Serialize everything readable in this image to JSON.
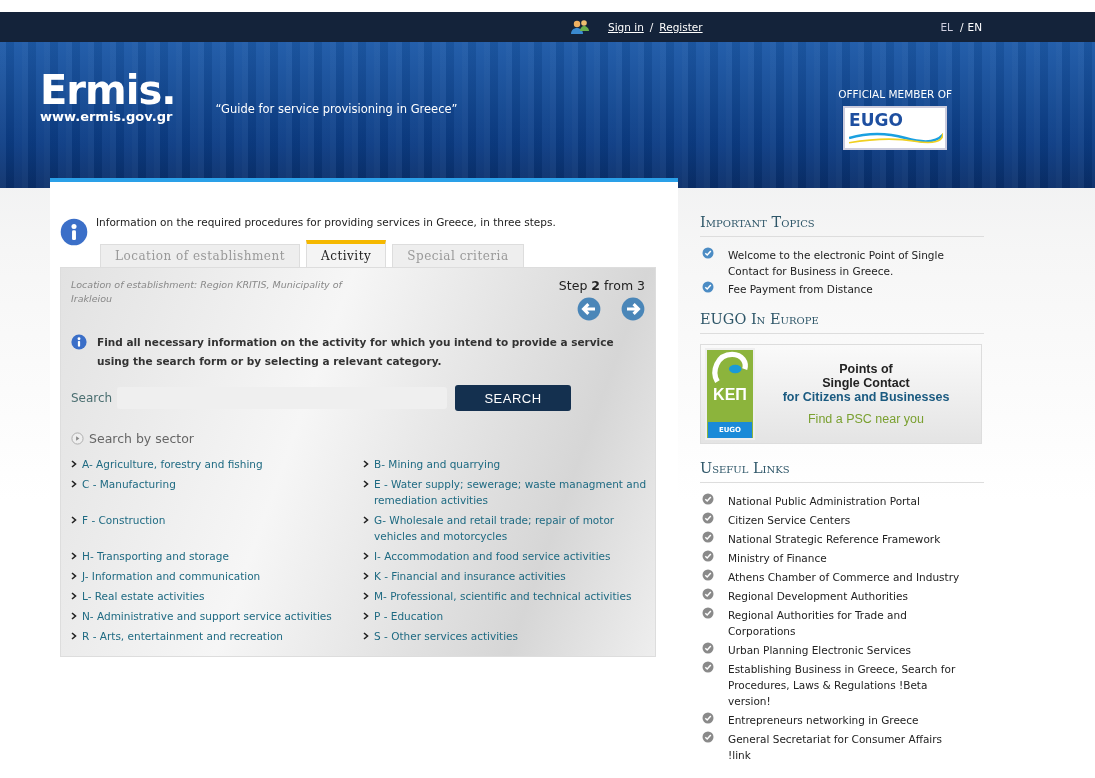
{
  "top_bar": {
    "sign_in": "Sign in",
    "separator": "/",
    "register": "Register",
    "languages": [
      {
        "label": "EL",
        "selected": false
      },
      {
        "label": "EN",
        "selected": true
      }
    ],
    "language_separator": "/"
  },
  "header": {
    "logo": "Ermis.",
    "site_url": "www.ermis.gov.gr",
    "tagline": "“Guide for service provisioning in Greece”",
    "member_label": "OFFICIAL MEMBER OF",
    "member_logo": "EUGO"
  },
  "intro": "Information on the required procedures for providing services in Greece, in three steps.",
  "tabs": [
    {
      "label": "Location of establishment",
      "selected": false
    },
    {
      "label": "Activity",
      "selected": true
    },
    {
      "label": "Special criteria",
      "selected": false
    }
  ],
  "location_note": "Location of establishment: Region KRITIS, Municipality of Irakleiou",
  "step": "Step **2** from 3",
  "hint": "Find all necessary information on the activity for which you intend to provide a service using the search form or by selecting a relevant category.",
  "search": {
    "label": "Search",
    "button": "SEARCH"
  },
  "sector_title": "Search by sector",
  "sectors": [
    "A- Agriculture, forestry and fishing",
    "B- Mining and quarrying",
    "C - Manufacturing",
    "E - Water supply; sewerage; waste managment and remediation activities",
    "F - Construction",
    "G- Wholesale and retail trade; repair of motor vehicles and motorcycles",
    "H- Transporting and storage",
    "I- Accommodation and food service activities",
    "J- Information and communication",
    "K - Financial and insurance activities",
    "L- Real estate activities",
    "M- Professional, scientific and technical activities",
    "N- Administrative and support service activities",
    "P - Education",
    "R - Arts, entertainment and recreation",
    "S - Other services activities"
  ],
  "important_topics": {
    "title": "Important Topics",
    "items": [
      "Welcome to the electronic Point of Single Contact for Business in Greece.",
      "Fee Payment from Distance"
    ]
  },
  "eugo": {
    "title": "EUGO In Europe",
    "logo_text": "KEΠ",
    "logo_badge": "EUGO",
    "lines": [
      "Points of",
      "Single Contact"
    ],
    "subtitle": "for Citizens and Businesses",
    "link": "Find a PSC near you"
  },
  "useful_links": {
    "title": "Useful Links",
    "items": [
      "National Public Administration Portal",
      "Citizen Service Centers",
      "National Strategic Reference Framework",
      "Ministry of Finance",
      "Athens Chamber of Commerce and Industry",
      "Regional Development Authorities",
      "Regional Authorities for Trade and Corporations",
      "Urban Planning Electronic Services",
      "Establishing Business in Greece, Search for Procedures, Laws & Regulations !Beta version!",
      "Entrepreneurs networking in Greece",
      "General Secretariat for Consumer Affairs !link"
    ]
  }
}
